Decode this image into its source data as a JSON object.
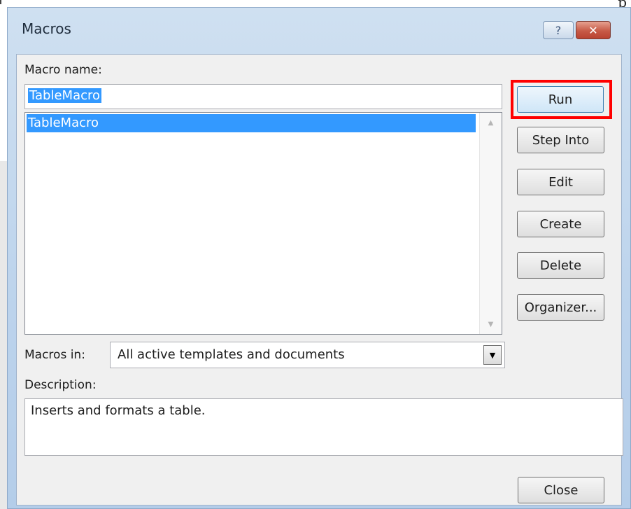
{
  "stray_char": "p",
  "dialog": {
    "title": "Macros",
    "help_glyph": "?",
    "close_glyph": "✕"
  },
  "macro_name": {
    "label": "Macro name:",
    "value": "TableMacro"
  },
  "macro_list": {
    "items": [
      "TableMacro"
    ],
    "selected_index": 0
  },
  "buttons": {
    "run": "Run",
    "step_into": "Step Into",
    "edit": "Edit",
    "create": "Create",
    "delete": "Delete",
    "organizer": "Organizer...",
    "close": "Close"
  },
  "macros_in": {
    "label": "Macros in:",
    "selected": "All active templates and documents"
  },
  "description": {
    "label": "Description:",
    "text": "Inserts and formats a table."
  },
  "colors": {
    "selection": "#3399ff",
    "highlight_border": "#ff0000"
  }
}
